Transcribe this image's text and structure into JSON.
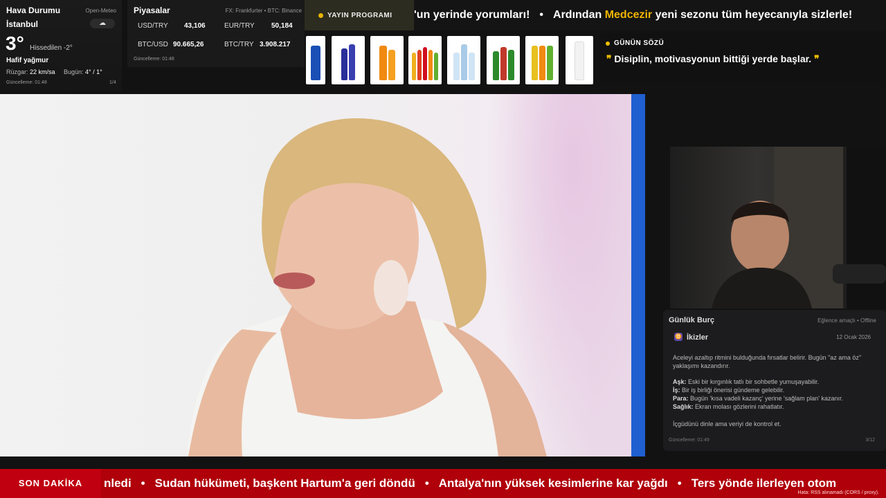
{
  "weather": {
    "title": "Hava Durumu",
    "source": "Open-Meteo",
    "city": "İstanbul",
    "temp": "3°",
    "feels": "Hissedilen -2°",
    "condition": "Hafif yağmur",
    "wind_label": "Rüzgar:",
    "wind_value": "22 km/sa",
    "today_label": "Bugün:",
    "today_value": "4° / 1°",
    "updated": "Güncelleme: 01:48",
    "page": "1/4",
    "icon": "cloud-rain-icon"
  },
  "markets": {
    "title": "Piyasalar",
    "source": "FX: Frankfurter • BTC: Binance",
    "usd_label": "USD/TRY",
    "usd_value": "43,106",
    "eur_label": "EUR/TRY",
    "eur_value": "50,184",
    "btcusd_label": "BTC/USD",
    "btcusd_value": "90.665,26",
    "btctry_label": "BTC/TRY",
    "btctry_value": "3.908.217",
    "updated": "Güncelleme: 01:48"
  },
  "schedule": {
    "label": "YAYIN PROGRAMI"
  },
  "top_ticker": {
    "part1": "'un yerinde yorumları!",
    "part2_pre": "Ardından ",
    "part2_hl": "Medcezir",
    "part2_post": " yeni sezonu tüm heyecanıyla sizlerle!",
    "accent": "#f0b400"
  },
  "quote": {
    "heading": "GÜNÜN SÖZÜ",
    "open_q": "❞",
    "text": " Disiplin, motivasyonun bittiği yerde başlar. ",
    "close_q": "❞"
  },
  "horoscope": {
    "title": "Günlük Burç",
    "meta": "Eğlence amaçlı • Offline",
    "sign_glyph": "♊",
    "sign": "İkizler",
    "date": "12 Ocak 2026",
    "intro": "Aceleyi azaltıp ritmini bulduğunda fırsatlar belirir. Bugün \"az ama öz\" yaklaşımı kazandırır.",
    "love_label": "Aşk:",
    "love": " Eski bir kırgınlık tatlı bir sohbetle yumuşayabilir.",
    "work_label": "İş:",
    "work": " Bir iş birliği önerisi gündeme gelebilir.",
    "money_label": "Para:",
    "money": " Bugün 'kısa vadeli kazanç' yerine 'sağlam plan' kazanır.",
    "health_label": "Sağlık:",
    "health": " Ekran molası gözlerini rahatlatır.",
    "closing": "İçgüdünü dinle ama veriyi de kontrol et.",
    "updated": "Güncelleme: 01:49",
    "page": "3/12"
  },
  "breaking": {
    "label": "SON DAKİKA",
    "items": [
      "nledi",
      "Sudan hükümeti, başkent Hartum'a geri döndü",
      "Antalya'nın yüksek kesimlerine kar yağdı",
      "Ters yönde ilerleyen otom"
    ],
    "error": "Hata: RSS alınamadı (CORS / proxy)."
  }
}
